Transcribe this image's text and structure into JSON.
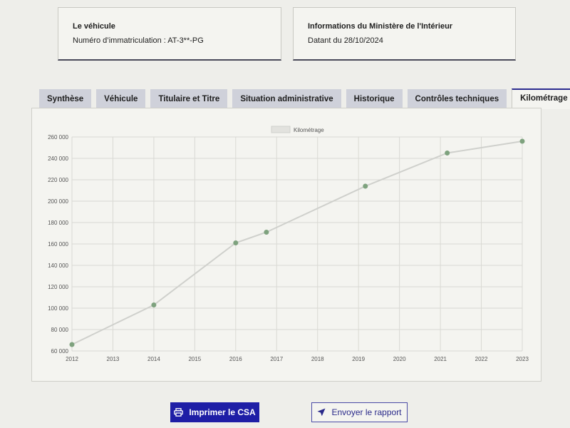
{
  "vehicle_card": {
    "title": "Le véhicule",
    "registration": "Numéro d’immatriculation : AT-3**-PG"
  },
  "ministry_card": {
    "title": "Informations du Ministère de l'Intérieur",
    "date": "Datant du 28/10/2024"
  },
  "tabs": [
    {
      "label": "Synthèse",
      "active": false
    },
    {
      "label": "Véhicule",
      "active": false
    },
    {
      "label": "Titulaire et Titre",
      "active": false
    },
    {
      "label": "Situation administrative",
      "active": false
    },
    {
      "label": "Historique",
      "active": false
    },
    {
      "label": "Contrôles techniques",
      "active": false
    },
    {
      "label": "Kilométrage",
      "active": true
    }
  ],
  "chart_data": {
    "type": "line",
    "x_axis_type": "time",
    "xlim": [
      2012,
      2023
    ],
    "ylim": [
      60000,
      260000
    ],
    "x_ticks": [
      "2012",
      "2013",
      "2014",
      "2015",
      "2016",
      "2017",
      "2018",
      "2019",
      "2020",
      "2021",
      "2022",
      "2023"
    ],
    "y_ticks": [
      "60 000",
      "80 000",
      "100 000",
      "120 000",
      "140 000",
      "160 000",
      "180 000",
      "200 000",
      "220 000",
      "240 000",
      "260 000"
    ],
    "legend_position": "top-center",
    "grid": true,
    "series": [
      {
        "name": "Kilométrage",
        "line_color": "#cfd0cc",
        "point_color": "#7ea27e",
        "points": [
          {
            "x": "2012-01",
            "y": 66000
          },
          {
            "x": "2014-01",
            "y": 103000
          },
          {
            "x": "2016-01",
            "y": 161000
          },
          {
            "x": "2016-10",
            "y": 171000
          },
          {
            "x": "2019-03",
            "y": 214000
          },
          {
            "x": "2021-03",
            "y": 245000
          },
          {
            "x": "2023-01",
            "y": 256000
          }
        ]
      }
    ]
  },
  "actions": {
    "print_label": "Imprimer le CSA",
    "send_label": "Envoyer le rapport"
  },
  "colors": {
    "primary": "#1e1ea6",
    "tab_inactive": "#cfd1da",
    "active_tab_border": "#2b2b8f"
  }
}
